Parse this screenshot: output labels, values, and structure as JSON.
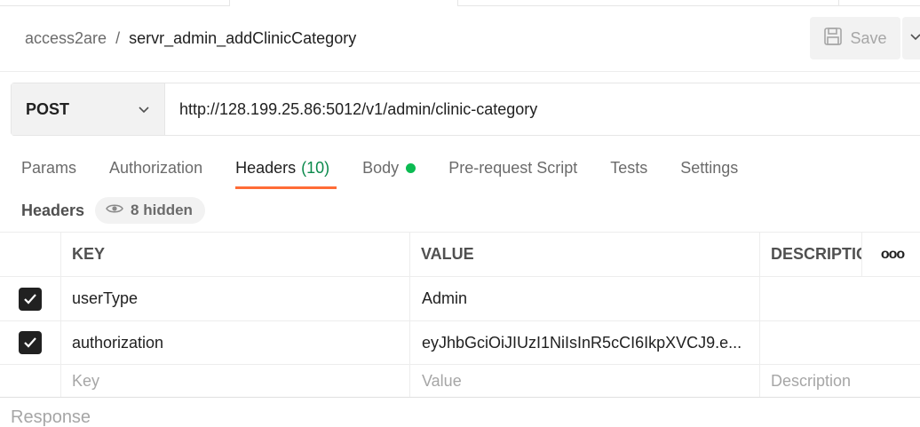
{
  "breadcrumb": {
    "parent": "access2are",
    "separator": "/",
    "current": "servr_admin_addClinicCategory"
  },
  "toolbar": {
    "save_label": "Save"
  },
  "request": {
    "method": "POST",
    "url": "http://128.199.25.86:5012/v1/admin/clinic-category"
  },
  "tabs": {
    "params": "Params",
    "authorization": "Authorization",
    "headers": "Headers",
    "headers_count": "(10)",
    "body": "Body",
    "prerequest": "Pre-request Script",
    "tests": "Tests",
    "settings": "Settings"
  },
  "headers_section": {
    "label": "Headers",
    "hidden_label": "8 hidden"
  },
  "table": {
    "columns": {
      "key": "KEY",
      "value": "VALUE",
      "description": "DESCRIPTIO",
      "more": "ooo"
    },
    "rows": [
      {
        "key": "userType",
        "value": "Admin",
        "description": "",
        "checked": true
      },
      {
        "key": "authorization",
        "value": "eyJhbGciOiJIUzI1NiIsInR5cCI6IkpXVCJ9.e...",
        "description": "",
        "checked": true
      }
    ],
    "placeholders": {
      "key": "Key",
      "value": "Value",
      "description": "Description"
    }
  },
  "response": {
    "label": "Response"
  },
  "colors": {
    "accent": "#ff6c37",
    "count": "#0b8a4c",
    "dot": "#0cbb52"
  }
}
